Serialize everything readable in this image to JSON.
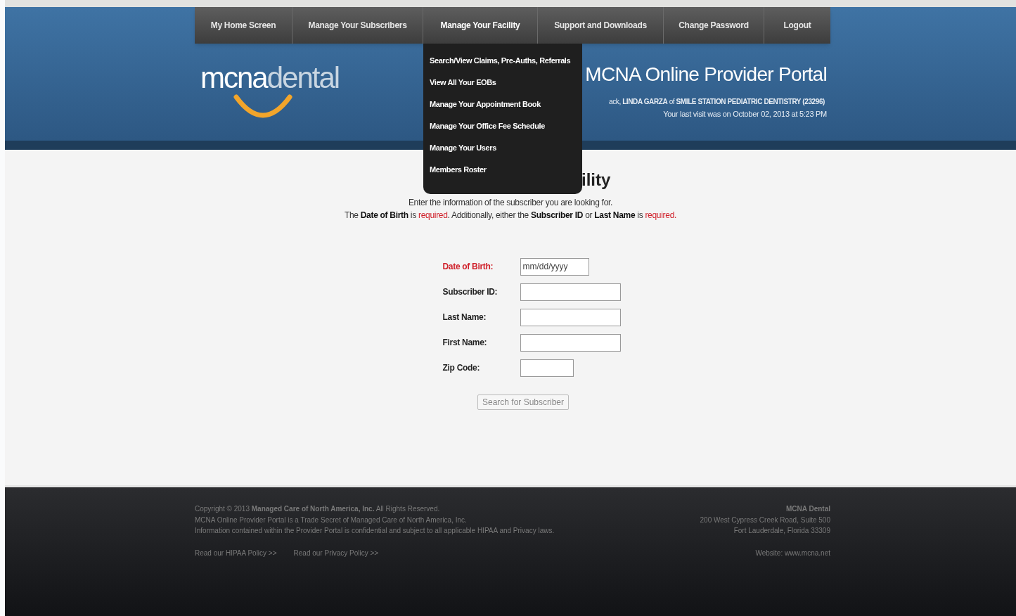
{
  "nav": [
    {
      "label": "My Home Screen",
      "expanded": false
    },
    {
      "label": "Manage Your Subscribers",
      "expanded": false
    },
    {
      "label": "Manage Your Facility",
      "expanded": true,
      "menu": [
        "Search/View Claims, Pre-Auths, Referrals",
        "View All Your EOBs",
        "Manage Your Appointment Book",
        "Manage Your Office Fee Schedule",
        "Manage Your Users",
        "Members Roster"
      ]
    },
    {
      "label": "Support and Downloads",
      "expanded": false
    },
    {
      "label": "Change Password",
      "expanded": false
    },
    {
      "label": "Logout",
      "expanded": false
    }
  ],
  "logo": {
    "first": "mcna",
    "second": "dental"
  },
  "portal_title": "MCNA Online Provider Portal",
  "welcome": "ack, **LINDA GARZA** of **SMILE STATION PEDIATRIC DENTISTRY (23296)**",
  "last_visit": "Your last visit was on October 02, 2013 at 5:23 PM",
  "heading": "ility",
  "instructions": [
    [
      {
        "text": "Enter the information of the subscriber you are looking for.",
        "kind": "plain"
      }
    ],
    [
      {
        "text": "The ",
        "kind": "plain"
      },
      {
        "text": "Date of Birth",
        "kind": "bold"
      },
      {
        "text": " is ",
        "kind": "plain"
      },
      {
        "text": "required",
        "kind": "required"
      },
      {
        "text": ". Additionally, either the ",
        "kind": "plain"
      },
      {
        "text": "Subscriber ID",
        "kind": "bold"
      },
      {
        "text": " or ",
        "kind": "plain"
      },
      {
        "text": "Last Name",
        "kind": "bold"
      },
      {
        "text": " is ",
        "kind": "plain"
      },
      {
        "text": "required.",
        "kind": "required"
      }
    ]
  ],
  "fields": [
    {
      "label": "Date of Birth:",
      "kind": "date",
      "required": true,
      "placeholder": "mm/dd/yyyy"
    },
    {
      "label": "Subscriber ID:",
      "kind": "text",
      "required": false
    },
    {
      "label": "Last Name:",
      "kind": "text",
      "required": false
    },
    {
      "label": "First Name:",
      "kind": "text",
      "required": false
    },
    {
      "label": "Zip Code:",
      "kind": "zip",
      "required": false
    }
  ],
  "search_button": "Search for Subscriber",
  "footer": {
    "lines": [
      "Copyright © 2013 **Managed Care of North America, Inc.** All Rights Reserved.",
      "MCNA Online Provider Portal is a Trade Secret of Managed Care of North America, Inc.",
      "Information contained within the Provider Portal is confidential and subject to all applicable HIPAA and Privacy laws."
    ],
    "links": [
      "Read our HIPAA Policy >>",
      "Read our Privacy Policy >>"
    ],
    "address": [
      "MCNA Dental",
      "200 West Cypress Creek Road, Suite 500",
      "Fort Lauderdale, Florida 33309"
    ],
    "website": "Website: www.mcna.net"
  }
}
